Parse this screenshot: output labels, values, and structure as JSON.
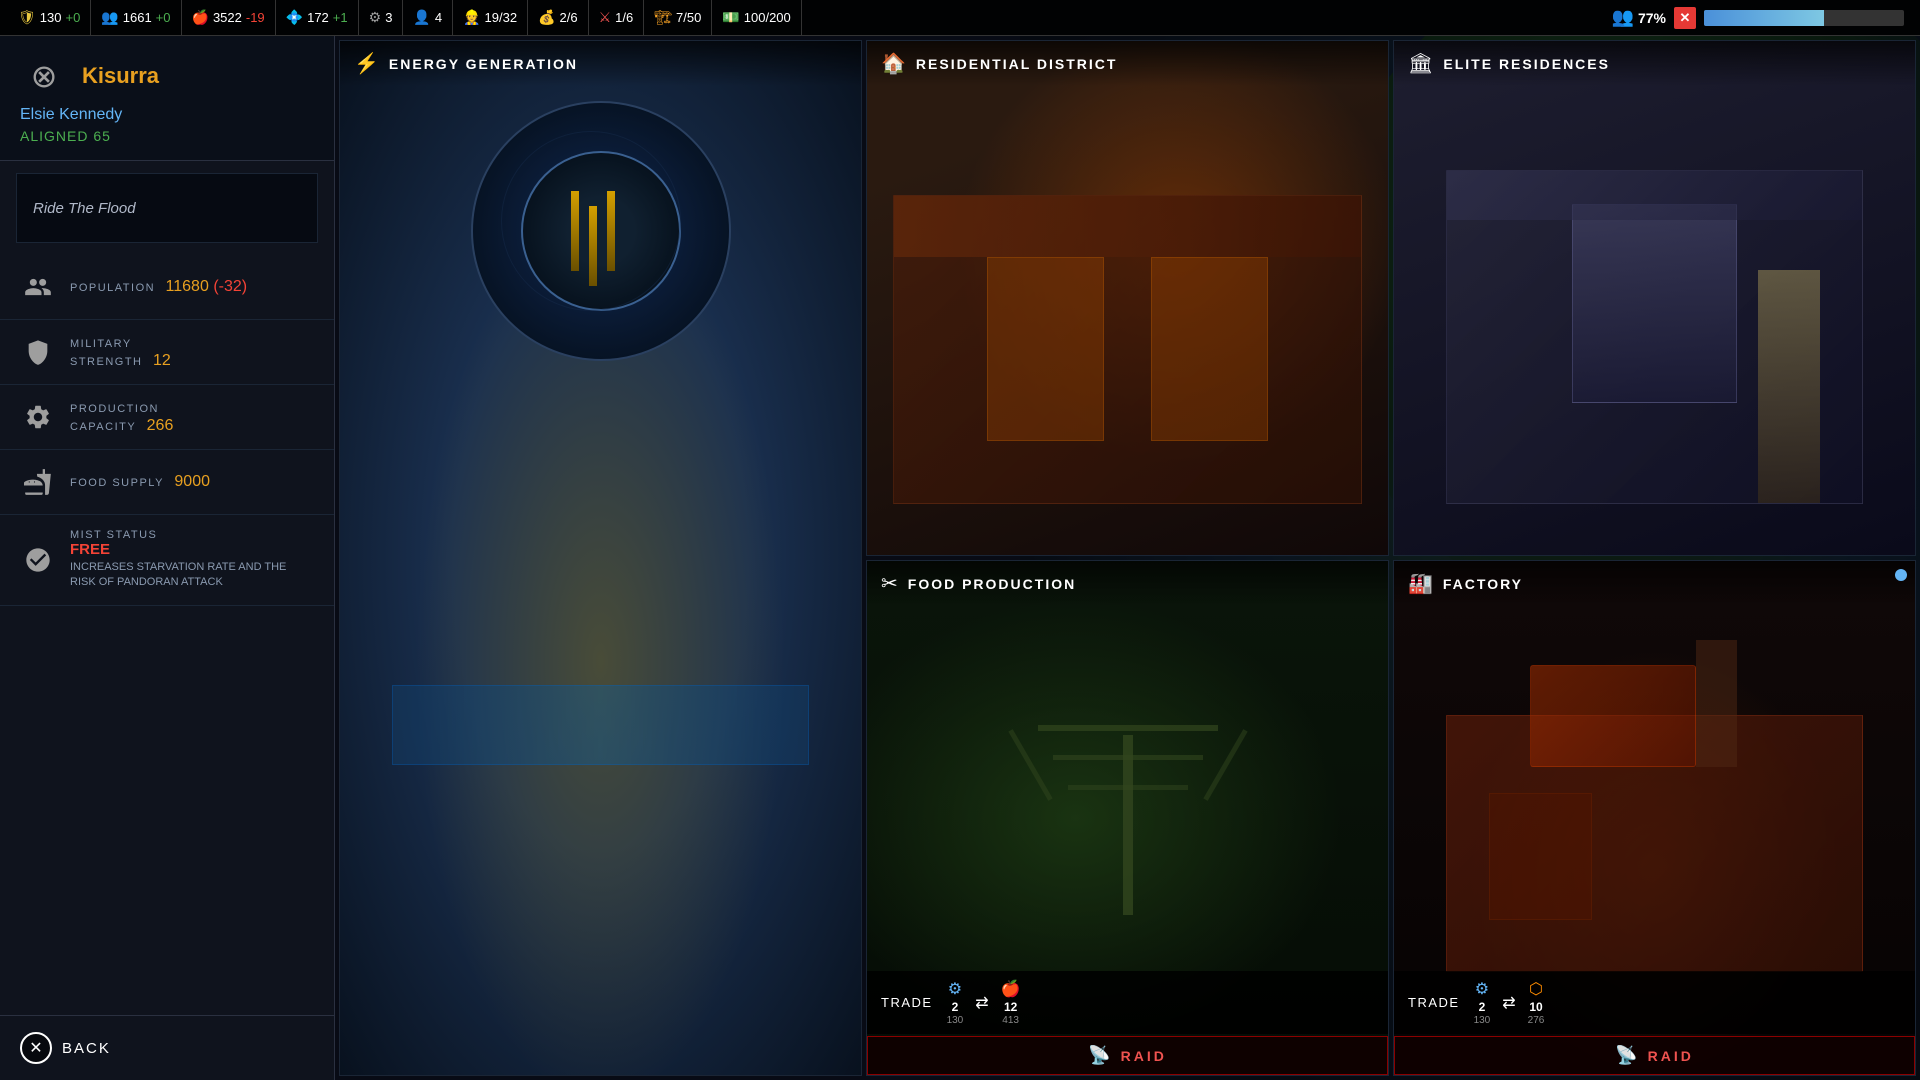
{
  "topbar": {
    "shield": {
      "icon": "🛡",
      "val": "130",
      "delta": "+0",
      "delta_class": "delta-neu"
    },
    "pop": {
      "icon": "👥",
      "val": "1661",
      "delta": "+0",
      "delta_class": "delta-neu"
    },
    "food": {
      "icon": "🍎",
      "val": "3522",
      "delta": "-19",
      "delta_class": "delta-neg"
    },
    "prod": {
      "icon": "💠",
      "val": "172",
      "delta": "+1",
      "delta_class": "delta-pos"
    },
    "gear": {
      "icon": "⚙",
      "val": "3",
      "delta": "",
      "delta_class": ""
    },
    "agent": {
      "icon": "👤",
      "val": "4",
      "delta": "",
      "delta_class": ""
    },
    "workers": {
      "icon": "👷",
      "val": "19/32",
      "delta": "",
      "delta_class": ""
    },
    "trade": {
      "icon": "💰",
      "val": "2/6",
      "delta": "",
      "delta_class": ""
    },
    "combat": {
      "icon": "⚔",
      "val": "1/6",
      "delta": "",
      "delta_class": ""
    },
    "building": {
      "icon": "🏗",
      "val": "7/50",
      "delta": "",
      "delta_class": ""
    },
    "money": {
      "icon": "💵",
      "val": "100/200",
      "delta": "",
      "delta_class": ""
    },
    "diplomacy_icon": "👥",
    "diplomacy_pct": "77%",
    "progress_width": "60%"
  },
  "left_panel": {
    "faction_name": "Kisurra",
    "leader_name": "Elsie Kennedy",
    "aligned_label": "ALIGNED",
    "aligned_value": "65",
    "mission_text": "Ride The Flood",
    "stats": [
      {
        "id": "population",
        "label": "POPULATION",
        "value": "11680",
        "extra": "(-32)",
        "extra_class": "stat-value-neg"
      },
      {
        "id": "military",
        "label": "MILITARY\nSTRENGTH",
        "value": "12",
        "extra": "",
        "extra_class": ""
      },
      {
        "id": "production",
        "label": "PRODUCTION\nCAPACITY",
        "value": "266",
        "extra": "",
        "extra_class": ""
      },
      {
        "id": "food",
        "label": "FOOD SUPPLY",
        "value": "9000",
        "extra": "",
        "extra_class": ""
      }
    ],
    "mist": {
      "label": "MIST STATUS",
      "value": "FREE",
      "description": "INCREASES STARVATION RATE AND THE RISK OF PANDORAN ATTACK"
    },
    "back_label": "BACK"
  },
  "buildings": [
    {
      "id": "energy",
      "title": "ENERGY GENERATION",
      "icon": "⚡",
      "scene_class": "scene-energy",
      "has_trade": false,
      "has_raid": false,
      "span": "large"
    },
    {
      "id": "residential",
      "title": "RESIDENTIAL DISTRICT",
      "icon": "🏠",
      "scene_class": "scene-residential",
      "has_trade": false,
      "has_raid": false,
      "span": "normal"
    },
    {
      "id": "elite",
      "title": "ELITE RESIDENCES",
      "icon": "🏛",
      "scene_class": "scene-elite",
      "has_trade": false,
      "has_raid": false,
      "span": "normal"
    },
    {
      "id": "food",
      "title": "FOOD PRODUCTION",
      "icon": "✂",
      "scene_class": "scene-food",
      "has_trade": true,
      "has_raid": true,
      "trade": {
        "label": "TRADE",
        "gear_count": "2",
        "gear_sub": "130",
        "food_count": "12",
        "food_sub": "413"
      },
      "raid_label": "RAID",
      "span": "normal"
    },
    {
      "id": "factory",
      "title": "FACTORY",
      "icon": "🏭",
      "scene_class": "scene-factory",
      "has_trade": true,
      "has_raid": true,
      "trade": {
        "label": "TRADE",
        "gear_count": "2",
        "gear_sub": "130",
        "hex_count": "10",
        "hex_sub": "276"
      },
      "raid_label": "RAID",
      "span": "normal"
    }
  ]
}
